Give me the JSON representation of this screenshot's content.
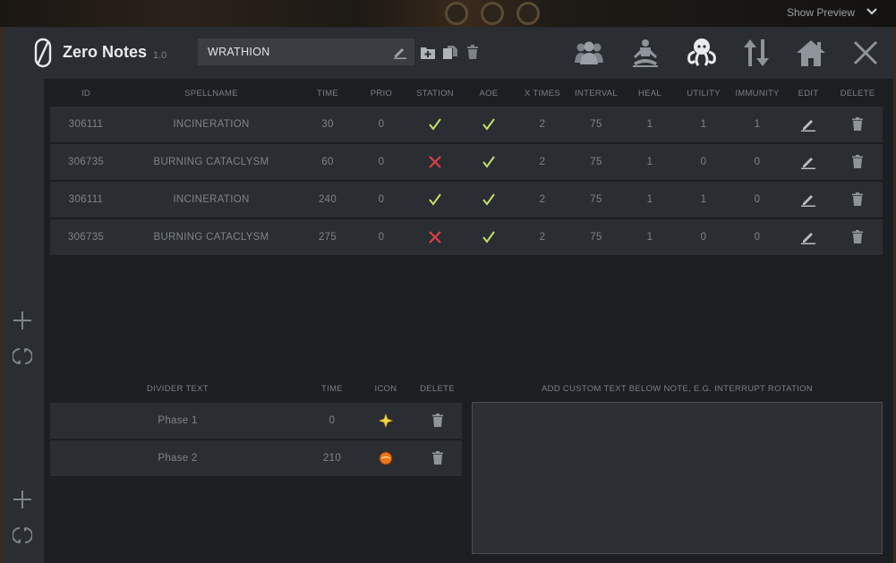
{
  "topbar": {
    "show_preview_label": "Show Preview"
  },
  "header": {
    "app_name": "Zero Notes",
    "version": "1.0",
    "note_name": "WRATHION",
    "icons": [
      "group-icon",
      "meditate-icon",
      "octopus-icon",
      "sort-arrows-icon",
      "home-icon",
      "close-icon"
    ]
  },
  "spell_table": {
    "columns": [
      "ID",
      "SPELLNAME",
      "TIME",
      "PRIO",
      "STATION",
      "AOE",
      "X TIMES",
      "INTERVAL",
      "HEAL",
      "UTILITY",
      "IMMUNITY",
      "EDIT",
      "DELETE"
    ],
    "rows": [
      {
        "id": "306111",
        "spellname": "INCINERATION",
        "time": "30",
        "prio": "0",
        "station": true,
        "aoe": true,
        "xtimes": "2",
        "interval": "75",
        "heal": "1",
        "utility": "1",
        "immunity": "1"
      },
      {
        "id": "306735",
        "spellname": "BURNING CATACLYSM",
        "time": "60",
        "prio": "0",
        "station": false,
        "aoe": true,
        "xtimes": "2",
        "interval": "75",
        "heal": "1",
        "utility": "0",
        "immunity": "0"
      },
      {
        "id": "306111",
        "spellname": "INCINERATION",
        "time": "240",
        "prio": "0",
        "station": true,
        "aoe": true,
        "xtimes": "2",
        "interval": "75",
        "heal": "1",
        "utility": "1",
        "immunity": "0"
      },
      {
        "id": "306735",
        "spellname": "BURNING CATACLYSM",
        "time": "275",
        "prio": "0",
        "station": false,
        "aoe": true,
        "xtimes": "2",
        "interval": "75",
        "heal": "1",
        "utility": "0",
        "immunity": "0"
      }
    ]
  },
  "divider_table": {
    "columns": [
      "DIVIDER TEXT",
      "TIME",
      "ICON",
      "DELETE"
    ],
    "rows": [
      {
        "text": "Phase 1",
        "time": "0",
        "icon": "star-icon"
      },
      {
        "text": "Phase 2",
        "time": "210",
        "icon": "orange-orb-icon"
      }
    ]
  },
  "custom_text": {
    "label": "ADD CUSTOM TEXT BELOW NOTE, E.G. INTERRUPT ROTATION",
    "value": ""
  },
  "colors": {
    "check": "#c4e06a",
    "cross": "#e0404a",
    "header_bg": "#2a2d31",
    "row_bg": "#2a2d31"
  }
}
